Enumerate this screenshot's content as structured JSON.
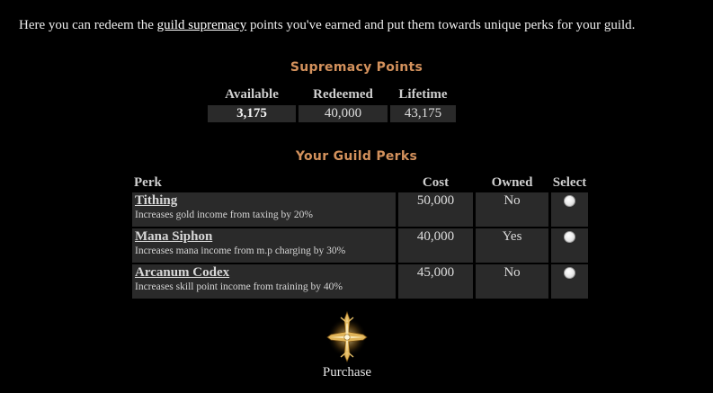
{
  "intro": {
    "before": "Here you can redeem the ",
    "link": "guild supremacy",
    "after": " points you've earned and put them towards unique perks for your guild."
  },
  "points": {
    "title": "Supremacy Points",
    "headers": {
      "available": "Available",
      "redeemed": "Redeemed",
      "lifetime": "Lifetime"
    },
    "values": {
      "available": "3,175",
      "redeemed": "40,000",
      "lifetime": "43,175"
    }
  },
  "perks": {
    "title": "Your Guild Perks",
    "headers": {
      "perk": "Perk",
      "cost": "Cost",
      "owned": "Owned",
      "select": "Select"
    },
    "rows": [
      {
        "name": "Tithing",
        "desc": "Increases gold income from taxing by 20%",
        "cost": "50,000",
        "owned": "No"
      },
      {
        "name": "Mana Siphon",
        "desc": "Increases mana income from m.p charging by 30%",
        "cost": "40,000",
        "owned": "Yes"
      },
      {
        "name": "Arcanum Codex",
        "desc": "Increases skill point income from training by 40%",
        "cost": "45,000",
        "owned": "No"
      }
    ]
  },
  "purchase": {
    "label": "Purchase",
    "icon": "golden-cross-icon"
  }
}
